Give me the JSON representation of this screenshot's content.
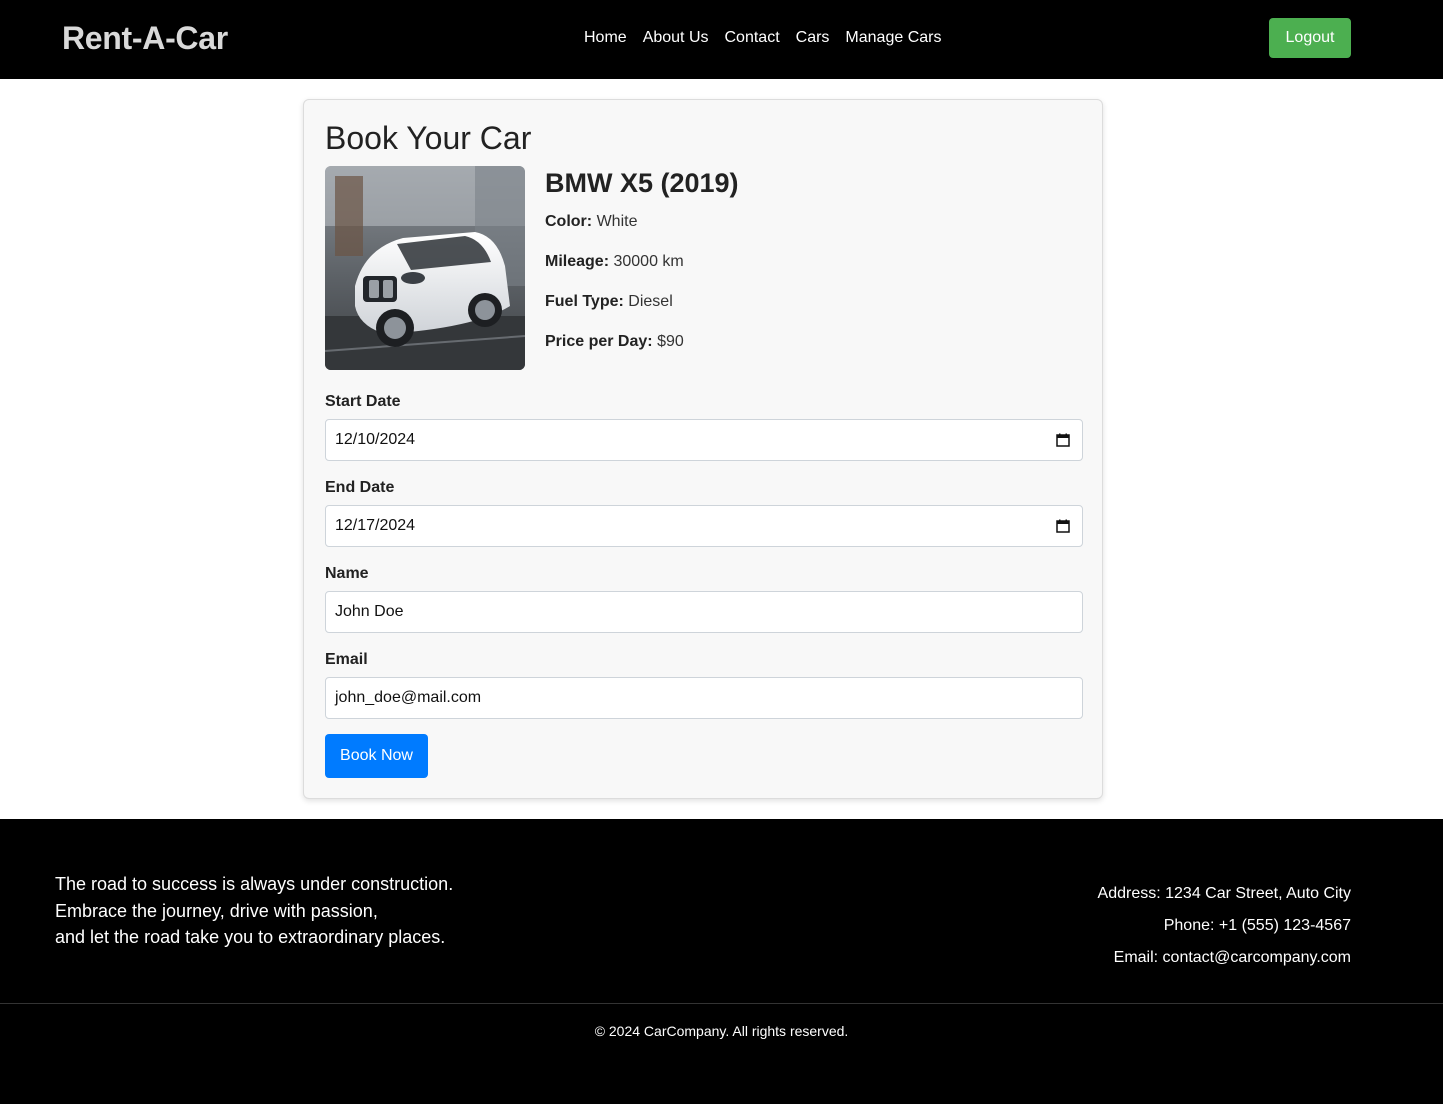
{
  "header": {
    "brand": "Rent-A-Car",
    "nav": [
      "Home",
      "About Us",
      "Contact",
      "Cars",
      "Manage Cars"
    ],
    "logout_label": "Logout"
  },
  "booking": {
    "title": "Book Your Car",
    "car": {
      "name": "BMW X5 (2019)",
      "specs": [
        {
          "label": "Color:",
          "value": "White"
        },
        {
          "label": "Mileage:",
          "value": "30000 km"
        },
        {
          "label": "Fuel Type:",
          "value": "Diesel"
        },
        {
          "label": "Price per Day:",
          "value": "$90"
        }
      ]
    },
    "fields": [
      {
        "label": "Start Date",
        "value": "12/10/2024",
        "type": "date"
      },
      {
        "label": "End Date",
        "value": "12/17/2024",
        "type": "date"
      },
      {
        "label": "Name",
        "value": "John Doe",
        "type": "text"
      },
      {
        "label": "Email",
        "value": "john_doe@mail.com",
        "type": "email"
      }
    ],
    "submit_label": "Book Now"
  },
  "footer": {
    "quote": [
      "The road to success is always under construction.",
      "Embrace the journey, drive with passion,",
      "and let the road take you to extraordinary places."
    ],
    "contact": [
      "Address: 1234 Car Street, Auto City",
      "Phone: +1 (555) 123-4567",
      "Email: contact@carcompany.com"
    ],
    "copyright": "© 2024 CarCompany. All rights reserved."
  },
  "colors": {
    "header_bg": "#000000",
    "logout_green": "#4caf50",
    "primary_blue": "#007bff",
    "card_bg": "#f8f8f8"
  },
  "icons": [
    "calendar-icon"
  ]
}
